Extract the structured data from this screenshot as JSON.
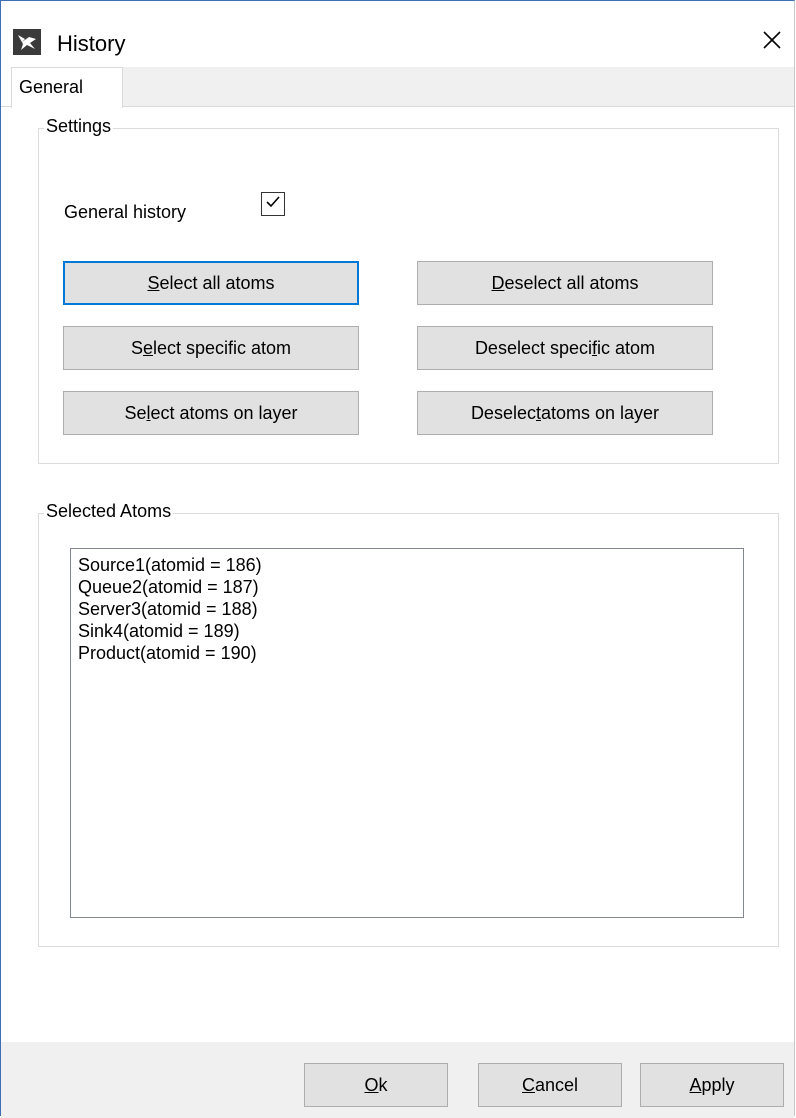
{
  "window": {
    "title": "History",
    "icon": "app-logo-icon",
    "close_icon": "close-icon"
  },
  "tabs": [
    {
      "label": "General",
      "selected": true
    }
  ],
  "settings": {
    "legend": "Settings",
    "general_history_label": "General history",
    "general_history_checked": true,
    "buttons": {
      "select_all": {
        "pre": "",
        "mn": "S",
        "post": "elect all atoms"
      },
      "deselect_all": {
        "pre": "",
        "mn": "D",
        "post": "eselect all atoms"
      },
      "select_specific": {
        "pre": "S",
        "mn": "e",
        "post": "lect specific atom"
      },
      "deselect_specific": {
        "pre": "Deselect speci",
        "mn": "f",
        "post": "ic atom"
      },
      "select_layer": {
        "pre": "Se",
        "mn": "l",
        "post": "ect atoms on layer"
      },
      "deselect_layer": {
        "pre": "Deselec",
        "mn": "t",
        "post": " atoms on layer"
      }
    }
  },
  "selected_atoms": {
    "legend": "Selected Atoms",
    "items": [
      "Source1(atomid = 186)",
      "Queue2(atomid = 187)",
      "Server3(atomid = 188)",
      "Sink4(atomid = 189)",
      "Product(atomid = 190)"
    ]
  },
  "footer": {
    "ok": {
      "pre": "",
      "mn": "O",
      "post": "k"
    },
    "cancel": {
      "pre": "",
      "mn": "C",
      "post": "ancel"
    },
    "apply": {
      "pre": "",
      "mn": "A",
      "post": "pply"
    }
  },
  "colors": {
    "focus_border": "#0078d7",
    "button_bg": "#e1e1e1",
    "footer_bg": "#f0f0f0",
    "window_border": "#3c6fb5"
  }
}
